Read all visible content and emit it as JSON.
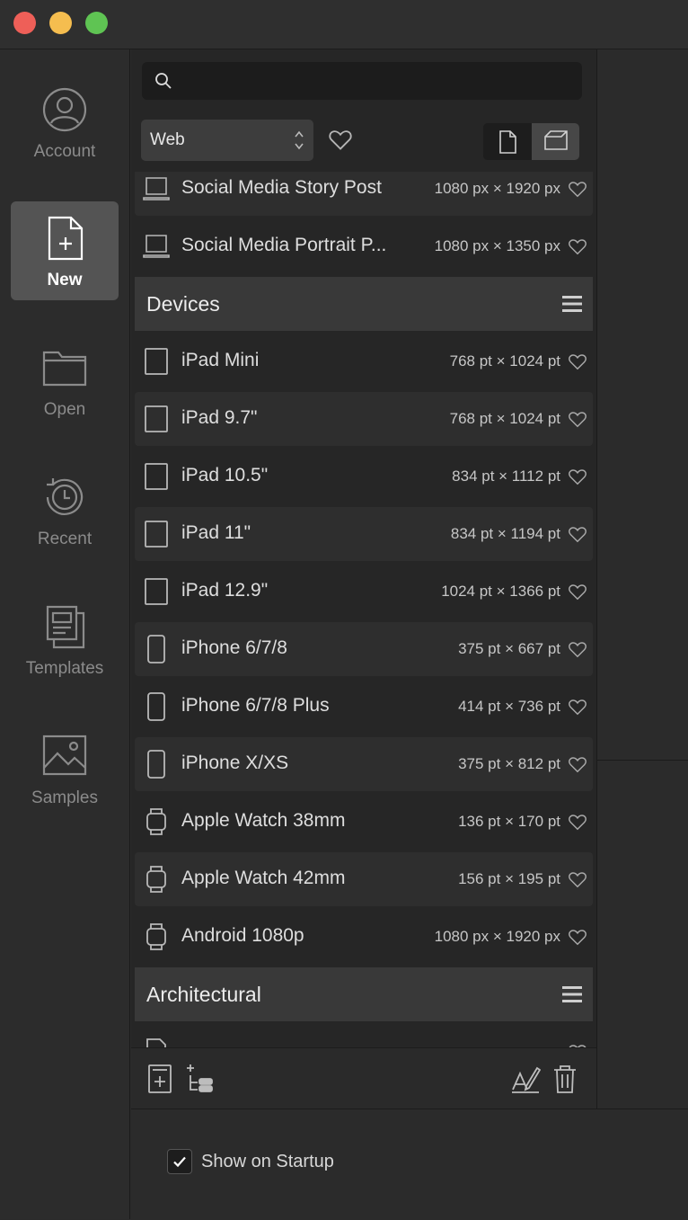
{
  "window": {
    "controls": [
      "close",
      "minimize",
      "zoom"
    ]
  },
  "sidebar": {
    "items": [
      {
        "label": "Account",
        "icon": "account-icon",
        "active": false
      },
      {
        "label": "New",
        "icon": "new-document-icon",
        "active": true
      },
      {
        "label": "Open",
        "icon": "folder-icon",
        "active": false
      },
      {
        "label": "Recent",
        "icon": "clock-history-icon",
        "active": false
      },
      {
        "label": "Templates",
        "icon": "templates-icon",
        "active": false
      },
      {
        "label": "Samples",
        "icon": "image-icon",
        "active": false
      }
    ]
  },
  "search": {
    "placeholder": "",
    "value": ""
  },
  "filter": {
    "category": "Web"
  },
  "list": {
    "top_rows": [
      {
        "name": "Social Media Story Post",
        "size": "1080 px × 1920 px",
        "icon": "laptop-icon"
      },
      {
        "name": "Social Media Portrait P...",
        "size": "1080 px × 1350 px",
        "icon": "laptop-icon"
      }
    ],
    "devices_title": "Devices",
    "devices": [
      {
        "name": "iPad Mini",
        "size": "768 pt × 1024 pt",
        "icon": "tablet-icon"
      },
      {
        "name": "iPad 9.7\"",
        "size": "768 pt × 1024 pt",
        "icon": "tablet-icon"
      },
      {
        "name": "iPad 10.5\"",
        "size": "834 pt × 1112 pt",
        "icon": "tablet-icon"
      },
      {
        "name": "iPad 11\"",
        "size": "834 pt × 1194 pt",
        "icon": "tablet-icon"
      },
      {
        "name": "iPad 12.9\"",
        "size": "1024 pt × 1366 pt",
        "icon": "tablet-icon"
      },
      {
        "name": "iPhone 6/7/8",
        "size": "375 pt × 667 pt",
        "icon": "phone-icon"
      },
      {
        "name": "iPhone 6/7/8 Plus",
        "size": "414 pt × 736 pt",
        "icon": "phone-icon"
      },
      {
        "name": "iPhone X/XS",
        "size": "375 pt × 812 pt",
        "icon": "phone-icon"
      },
      {
        "name": "Apple Watch 38mm",
        "size": "136 pt × 170 pt",
        "icon": "watch-icon"
      },
      {
        "name": "Apple Watch 42mm",
        "size": "156 pt × 195 pt",
        "icon": "watch-icon"
      },
      {
        "name": "Android 1080p",
        "size": "1080 px × 1920 px",
        "icon": "watch-icon"
      }
    ],
    "architectural_title": "Architectural"
  },
  "footer": {
    "buttons": [
      "add-preset-icon",
      "add-category-icon",
      "edit-preset-icon",
      "trash-icon"
    ]
  },
  "startup": {
    "label": "Show on Startup",
    "checked": true
  }
}
